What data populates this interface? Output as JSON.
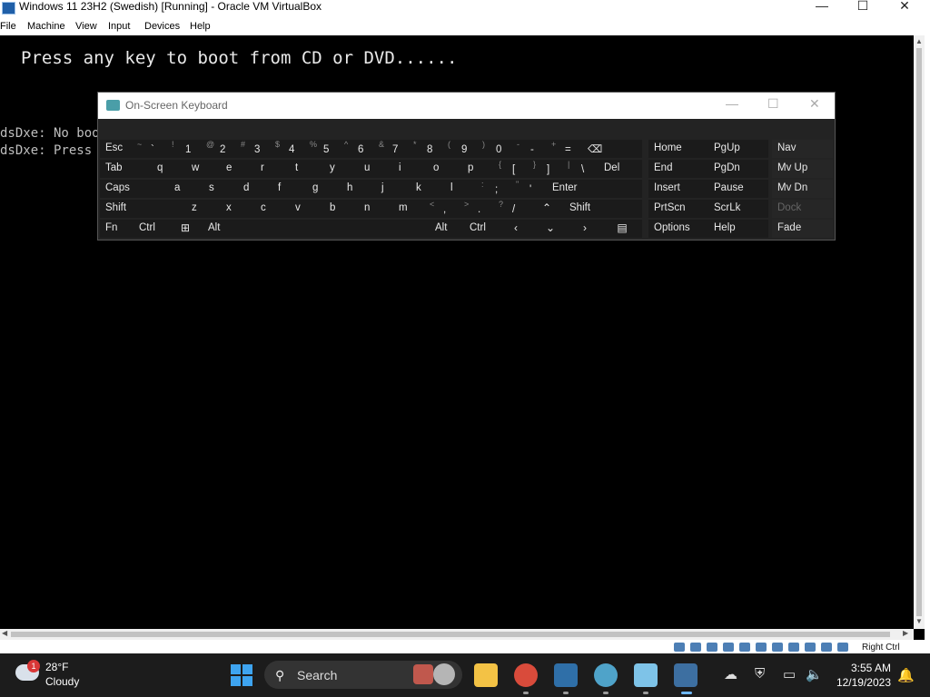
{
  "window": {
    "title": "Windows 11 23H2 (Swedish) [Running] - Oracle VM VirtualBox",
    "minimize_glyph": "—",
    "maximize_glyph": "☐",
    "close_glyph": "✕"
  },
  "menu": [
    "File",
    "Machine",
    "View",
    "Input",
    "Devices",
    "Help"
  ],
  "vm": {
    "boot_message": "Press any key to boot from CD or DVD......",
    "pxe_lines": [
      "dsDxe: No boot",
      "dsDxe: Press a"
    ]
  },
  "osk": {
    "title": "On-Screen Keyboard",
    "min_glyph": "—",
    "max_glyph": "☐",
    "close_glyph": "✕",
    "keys": {
      "esc": "Esc",
      "tab": "Tab",
      "caps": "Caps",
      "shift_l": "Shift",
      "fn": "Fn",
      "ctrl_l": "Ctrl",
      "alt_l": "Alt",
      "alt_r": "Alt",
      "ctrl_r": "Ctrl",
      "del": "Del",
      "enter": "Enter",
      "shift_r": "Shift",
      "backspace": "⌫",
      "left": "‹",
      "down": "⌄",
      "right": "›",
      "up": "⌃",
      "menu": "▤",
      "win": "⊞"
    },
    "num_row": [
      {
        "s": "~",
        "m": "`"
      },
      {
        "s": "!",
        "m": "1"
      },
      {
        "s": "@",
        "m": "2"
      },
      {
        "s": "#",
        "m": "3"
      },
      {
        "s": "$",
        "m": "4"
      },
      {
        "s": "%",
        "m": "5"
      },
      {
        "s": "^",
        "m": "6"
      },
      {
        "s": "&",
        "m": "7"
      },
      {
        "s": "*",
        "m": "8"
      },
      {
        "s": "(",
        "m": "9"
      },
      {
        "s": ")",
        "m": "0"
      },
      {
        "s": "-",
        "m": "-"
      },
      {
        "s": "+",
        "m": "="
      }
    ],
    "qwerty_row": [
      "q",
      "w",
      "e",
      "r",
      "t",
      "y",
      "u",
      "i",
      "o",
      "p"
    ],
    "qwerty_extras": [
      {
        "s": "{",
        "m": "["
      },
      {
        "s": "}",
        "m": "]"
      },
      {
        "s": "|",
        "m": "\\"
      }
    ],
    "asdf_row": [
      "a",
      "s",
      "d",
      "f",
      "g",
      "h",
      "j",
      "k",
      "l"
    ],
    "asdf_extras": [
      {
        "s": ":",
        "m": ";"
      },
      {
        "s": "\"",
        "m": "'"
      }
    ],
    "zxcv_row": [
      "z",
      "x",
      "c",
      "v",
      "b",
      "n",
      "m"
    ],
    "zxcv_extras": [
      {
        "s": "<",
        "m": ","
      },
      {
        "s": ">",
        "m": "."
      },
      {
        "s": "?",
        "m": "/"
      }
    ],
    "nav": [
      [
        "Home",
        "PgUp",
        "Nav"
      ],
      [
        "End",
        "PgDn",
        "Mv Up"
      ],
      [
        "Insert",
        "Pause",
        "Mv Dn"
      ],
      [
        "PrtScn",
        "ScrLk",
        "Dock"
      ],
      [
        "Options",
        "Help",
        "Fade"
      ]
    ]
  },
  "statusbar": {
    "host_key": "Right Ctrl"
  },
  "taskbar": {
    "weather_badge": "1",
    "temperature": "28°F",
    "condition": "Cloudy",
    "search_label": "Search",
    "time": "3:55 AM",
    "date": "12/19/2023"
  }
}
